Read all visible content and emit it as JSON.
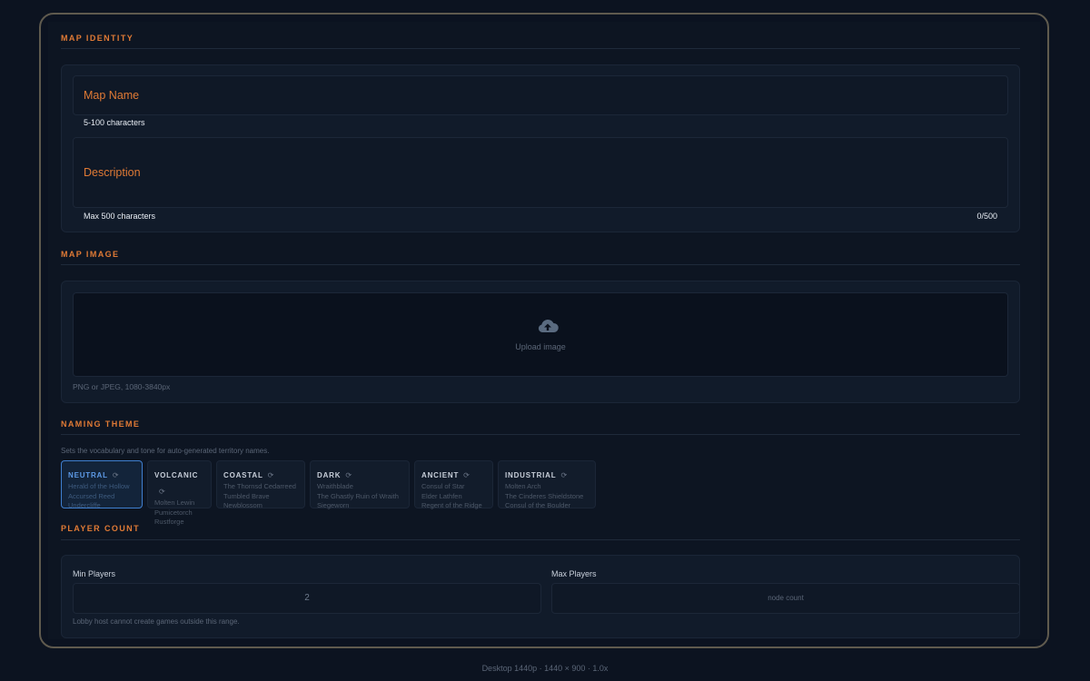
{
  "map_identity": {
    "section_title": "MAP IDENTITY",
    "map_name": {
      "label": "Map Name",
      "hint": "5-100 characters"
    },
    "description": {
      "label": "Description",
      "hint": "Max 500 characters",
      "counter": "0/500"
    }
  },
  "map_image": {
    "section_title": "MAP IMAGE",
    "upload_label": "Upload image",
    "hint": "PNG or JPEG, 1080-3840px",
    "icon": "cloud-upload-icon"
  },
  "naming_theme": {
    "section_title": "NAMING THEME",
    "description": "Sets the vocabulary and tone for auto-generated territory names.",
    "reroll_icon": "refresh-icon",
    "themes": [
      {
        "name": "NEUTRAL",
        "selected": true,
        "examples": [
          "Herald of the Hollow",
          "Accursed Reed",
          "Undercliffe"
        ]
      },
      {
        "name": "VOLCANIC",
        "selected": false,
        "examples": [
          "Molten Lewin",
          "Pumicetorch",
          "Rustforge"
        ]
      },
      {
        "name": "COASTAL",
        "selected": false,
        "examples": [
          "The Thornsd Cedarreed",
          "Tumbled Brave",
          "Newblossom"
        ]
      },
      {
        "name": "DARK",
        "selected": false,
        "examples": [
          "Wraithblade",
          "The Ghastly Ruin of Wraith",
          "Siegeworn"
        ]
      },
      {
        "name": "ANCIENT",
        "selected": false,
        "examples": [
          "Consul of Star",
          "Elder Lathfen",
          "Regent of the Ridge"
        ]
      },
      {
        "name": "INDUSTRIAL",
        "selected": false,
        "examples": [
          "Molten Arch",
          "The Cinderes Shieldstone",
          "Consul of the Boulder"
        ]
      }
    ]
  },
  "player_count": {
    "section_title": "PLAYER COUNT",
    "min_label": "Min Players",
    "min_value": "2",
    "max_label": "Max Players",
    "max_placeholder": "node count",
    "hint": "Lobby host cannot create games outside this range."
  },
  "viewport_caption": "Desktop 1440p  ·  1440 × 900 · 1.0x",
  "colors": {
    "accent": "#e07a35",
    "selected": "#3f7fcf",
    "background": "#0d1522"
  }
}
